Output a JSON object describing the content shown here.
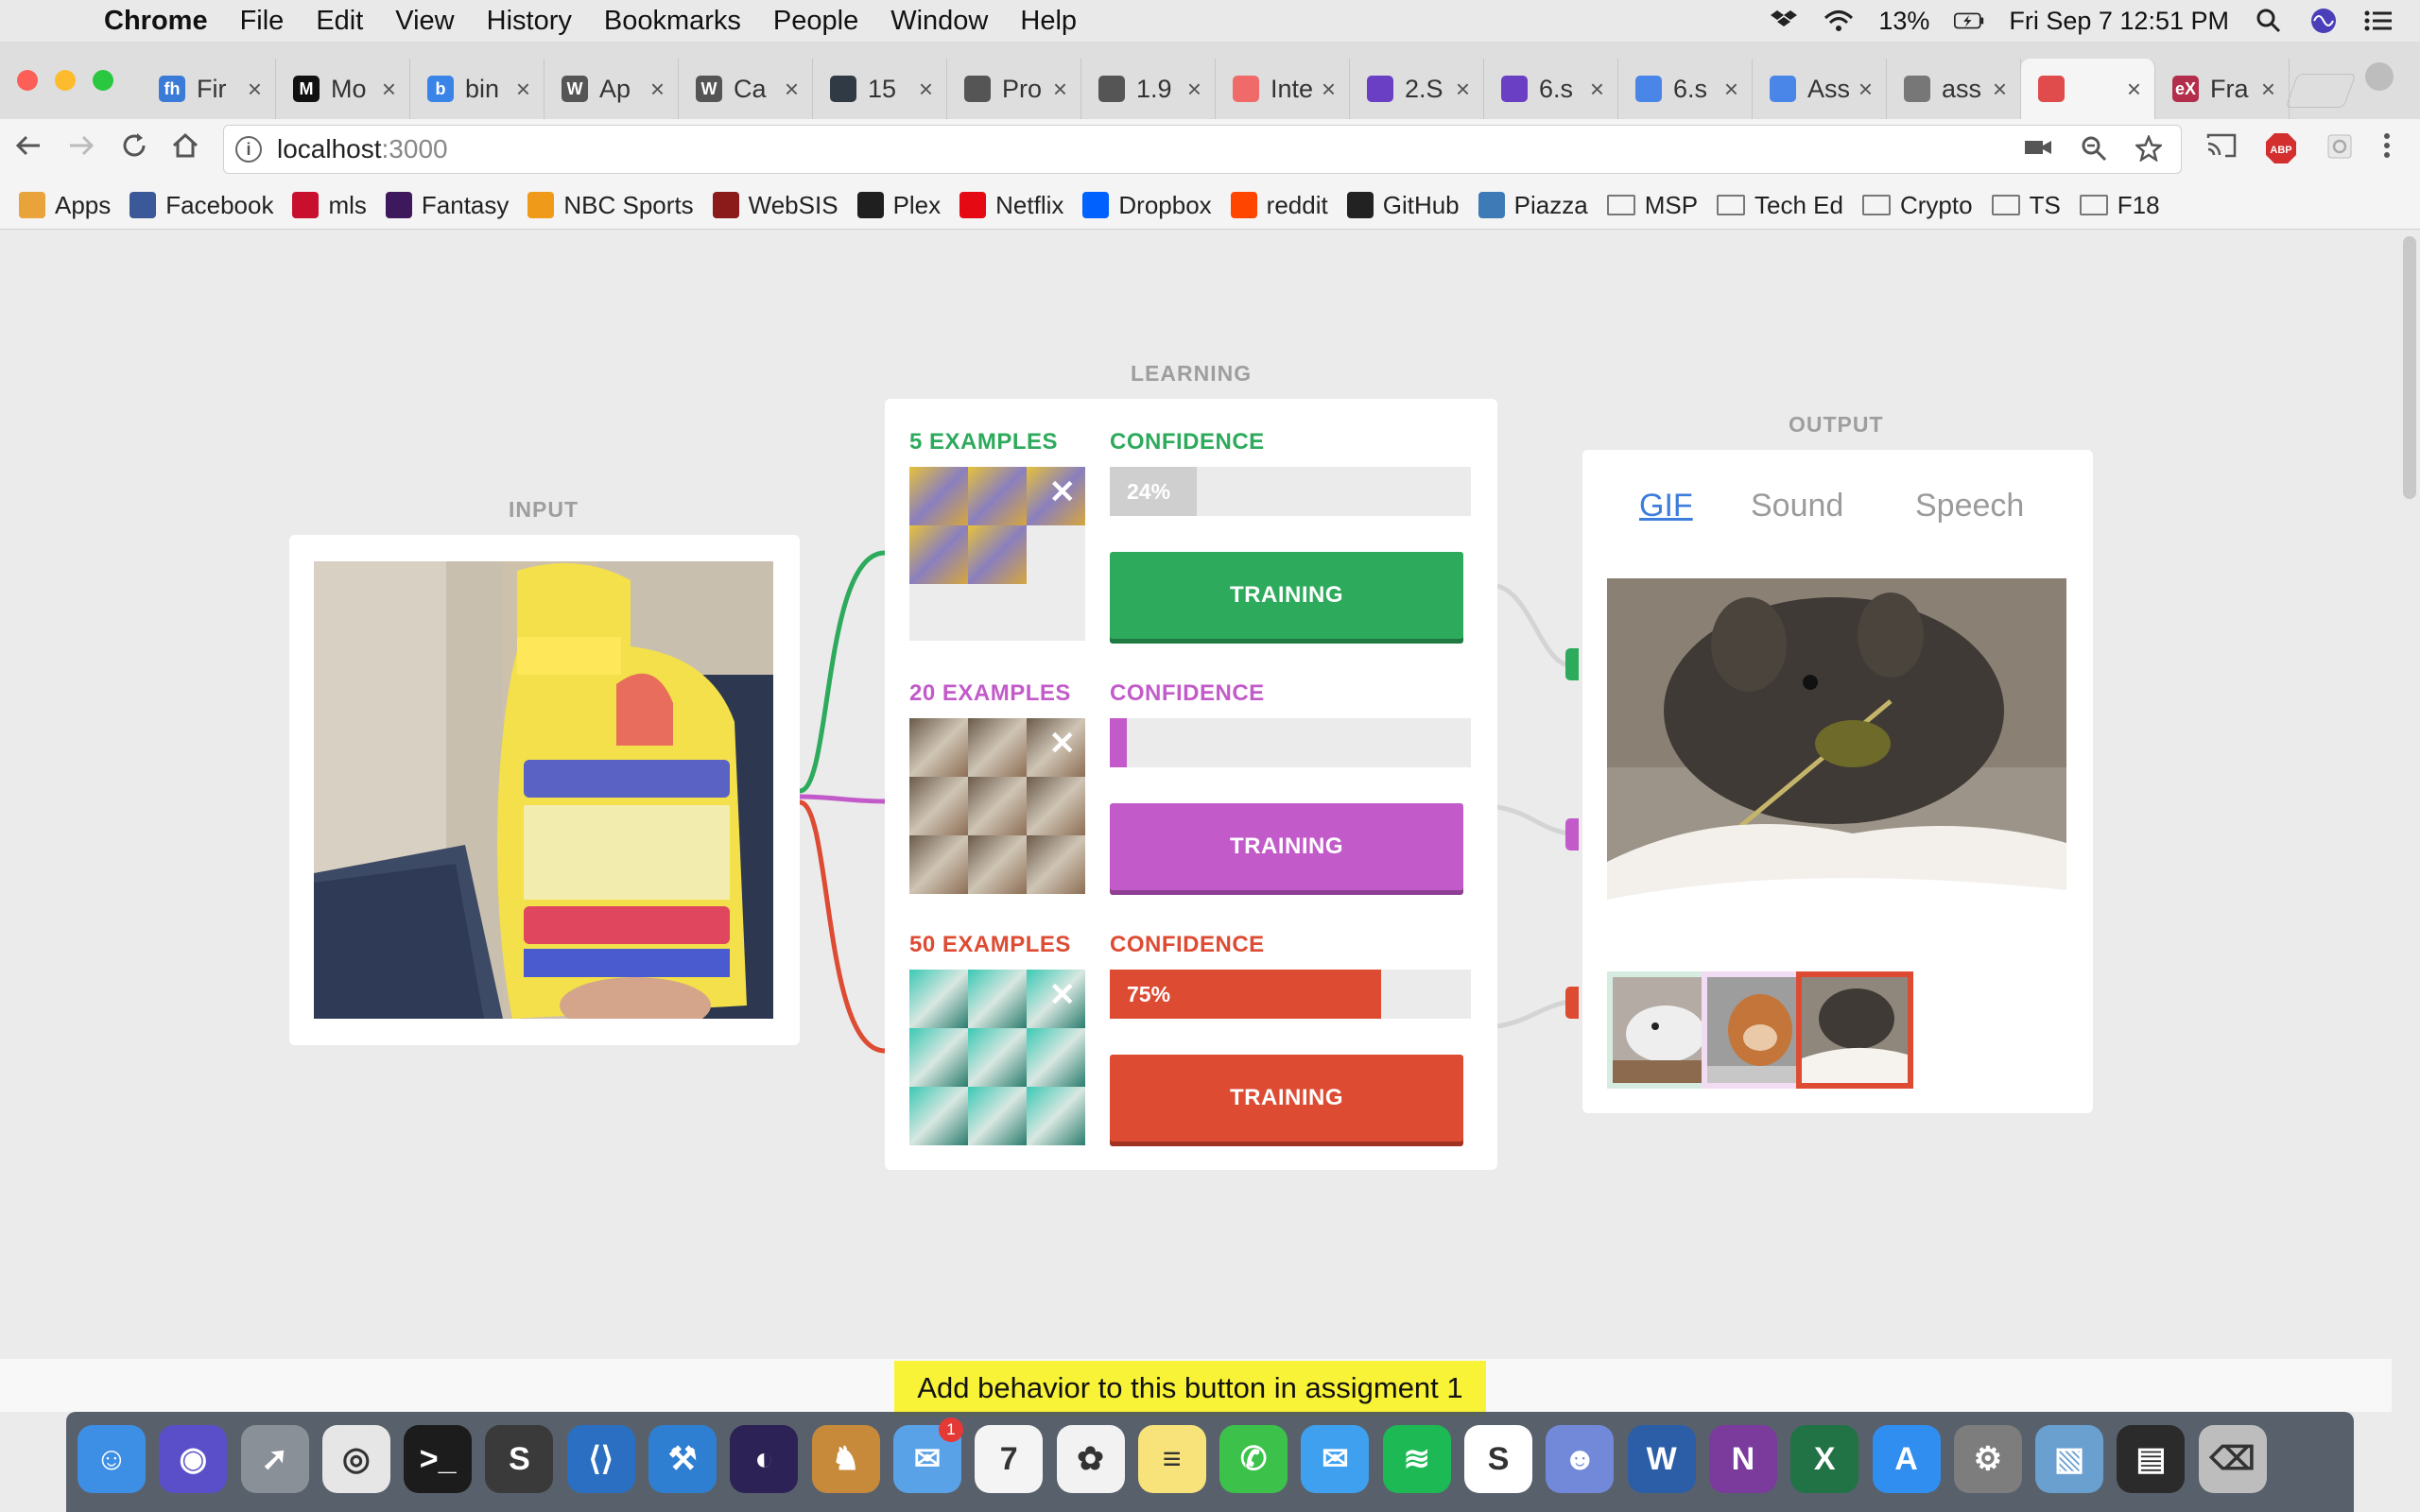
{
  "menubar": {
    "app_name": "Chrome",
    "items": [
      "File",
      "Edit",
      "View",
      "History",
      "Bookmarks",
      "People",
      "Window",
      "Help"
    ],
    "battery": "13%",
    "datetime": "Fri Sep 7  12:51 PM"
  },
  "tabs": [
    {
      "title": "Fir",
      "favicon": "fh",
      "color": "#3b7bd8"
    },
    {
      "title": "Mo",
      "favicon": "M",
      "color": "#111111"
    },
    {
      "title": "bin",
      "favicon": "b",
      "color": "#3a84e8"
    },
    {
      "title": "Ap",
      "favicon": "W",
      "color": "#555555"
    },
    {
      "title": "Ca",
      "favicon": "W",
      "color": "#555555"
    },
    {
      "title": "15",
      "favicon": "",
      "color": "#2f3a45"
    },
    {
      "title": "Pro",
      "favicon": "",
      "color": "#555555"
    },
    {
      "title": "1.9",
      "favicon": "",
      "color": "#555555"
    },
    {
      "title": "Inte",
      "favicon": "",
      "color": "#f06a6a"
    },
    {
      "title": "2.S",
      "favicon": "",
      "color": "#6a3fc4"
    },
    {
      "title": "6.s",
      "favicon": "",
      "color": "#6a3fc4"
    },
    {
      "title": "6.s",
      "favicon": "",
      "color": "#4a86e8"
    },
    {
      "title": "Ass",
      "favicon": "",
      "color": "#4a86e8"
    },
    {
      "title": "ass",
      "favicon": "",
      "color": "#777777"
    },
    {
      "title": "",
      "favicon": "",
      "color": "#e04b4b",
      "active": true
    },
    {
      "title": "Fra",
      "favicon": "eX",
      "color": "#b22e4a"
    }
  ],
  "address": {
    "host": "localhost",
    "port": ":3000"
  },
  "bookmarks": [
    {
      "label": "Apps",
      "icon": "apps-grid"
    },
    {
      "label": "Facebook",
      "icon": "facebook"
    },
    {
      "label": "mls",
      "icon": "mls"
    },
    {
      "label": "Fantasy",
      "icon": "premier-league"
    },
    {
      "label": "NBC Sports",
      "icon": "nbc"
    },
    {
      "label": "WebSIS",
      "icon": "websis"
    },
    {
      "label": "Plex",
      "icon": "plex"
    },
    {
      "label": "Netflix",
      "icon": "netflix"
    },
    {
      "label": "Dropbox",
      "icon": "dropbox"
    },
    {
      "label": "reddit",
      "icon": "reddit"
    },
    {
      "label": "GitHub",
      "icon": "github"
    },
    {
      "label": "Piazza",
      "icon": "piazza"
    },
    {
      "label": "MSP",
      "icon": "folder"
    },
    {
      "label": "Tech Ed",
      "icon": "folder"
    },
    {
      "label": "Crypto",
      "icon": "folder"
    },
    {
      "label": "TS",
      "icon": "folder"
    },
    {
      "label": "F18",
      "icon": "folder"
    }
  ],
  "app": {
    "input_label": "INPUT",
    "learning_label": "LEARNING",
    "output_label": "OUTPUT",
    "classes": [
      {
        "examples": "5 EXAMPLES",
        "confidence_label": "CONFIDENCE",
        "confidence_value": 0.24,
        "confidence_text": "24%",
        "button": "TRAINING",
        "color": "#2eaa5c",
        "fill_color": "#cfcfcf",
        "thumb_count": 5
      },
      {
        "examples": "20 EXAMPLES",
        "confidence_label": "CONFIDENCE",
        "confidence_value": 0.0,
        "confidence_text": "",
        "button": "TRAINING",
        "color": "#c25bc9",
        "fill_color": "#c25bc9",
        "thumb_count": 9
      },
      {
        "examples": "50 EXAMPLES",
        "confidence_label": "CONFIDENCE",
        "confidence_value": 0.75,
        "confidence_text": "75%",
        "button": "TRAINING",
        "color": "#dd4b33",
        "fill_color": "#dd4b33",
        "thumb_count": 9
      }
    ],
    "output_tabs": [
      "GIF",
      "Sound",
      "Speech"
    ],
    "hint_text": "Add behavior to this button in assigment 1"
  },
  "dock": [
    {
      "name": "finder",
      "color": "#3d8fe6",
      "glyph": "☺"
    },
    {
      "name": "siri",
      "color": "#5a4fc9",
      "glyph": "◉"
    },
    {
      "name": "launchpad",
      "color": "#8a9098",
      "glyph": "➚"
    },
    {
      "name": "chrome",
      "color": "#e6e6e6",
      "glyph": "◎"
    },
    {
      "name": "terminal",
      "color": "#1c1c1c",
      "glyph": ">_"
    },
    {
      "name": "sublime",
      "color": "#3a3a3a",
      "glyph": "S"
    },
    {
      "name": "vscode",
      "color": "#2a6fc1",
      "glyph": "⟨⟩"
    },
    {
      "name": "xcode",
      "color": "#2e7fd1",
      "glyph": "⚒"
    },
    {
      "name": "eclipse",
      "color": "#2c2255",
      "glyph": "◐"
    },
    {
      "name": "cyberduck",
      "color": "#c78a3a",
      "glyph": "♞"
    },
    {
      "name": "mail",
      "color": "#5aa2e8",
      "glyph": "✉",
      "badge": "1"
    },
    {
      "name": "calendar",
      "color": "#f4f4f4",
      "glyph": "7"
    },
    {
      "name": "photos",
      "color": "#f2f2f2",
      "glyph": "✿"
    },
    {
      "name": "notes",
      "color": "#f7e37a",
      "glyph": "≡"
    },
    {
      "name": "facetime",
      "color": "#3cc24a",
      "glyph": "✆"
    },
    {
      "name": "messages",
      "color": "#3fa0f0",
      "glyph": "✉"
    },
    {
      "name": "spotify",
      "color": "#1db954",
      "glyph": "≋"
    },
    {
      "name": "slack",
      "color": "#ffffff",
      "glyph": "S"
    },
    {
      "name": "discord",
      "color": "#7289da",
      "glyph": "☻"
    },
    {
      "name": "word",
      "color": "#2b5ea7",
      "glyph": "W"
    },
    {
      "name": "onenote",
      "color": "#7a3b9c",
      "glyph": "N"
    },
    {
      "name": "excel",
      "color": "#217346",
      "glyph": "X"
    },
    {
      "name": "app-store",
      "color": "#2f8ef0",
      "glyph": "A"
    },
    {
      "name": "system-preferences",
      "color": "#7d7d7d",
      "glyph": "⚙"
    },
    {
      "name": "preview",
      "color": "#6aa0d0",
      "glyph": "▧"
    },
    {
      "name": "finder-window",
      "color": "#2b2b2b",
      "glyph": "▤"
    },
    {
      "name": "trash",
      "color": "#bdbdbd",
      "glyph": "⌫"
    }
  ]
}
